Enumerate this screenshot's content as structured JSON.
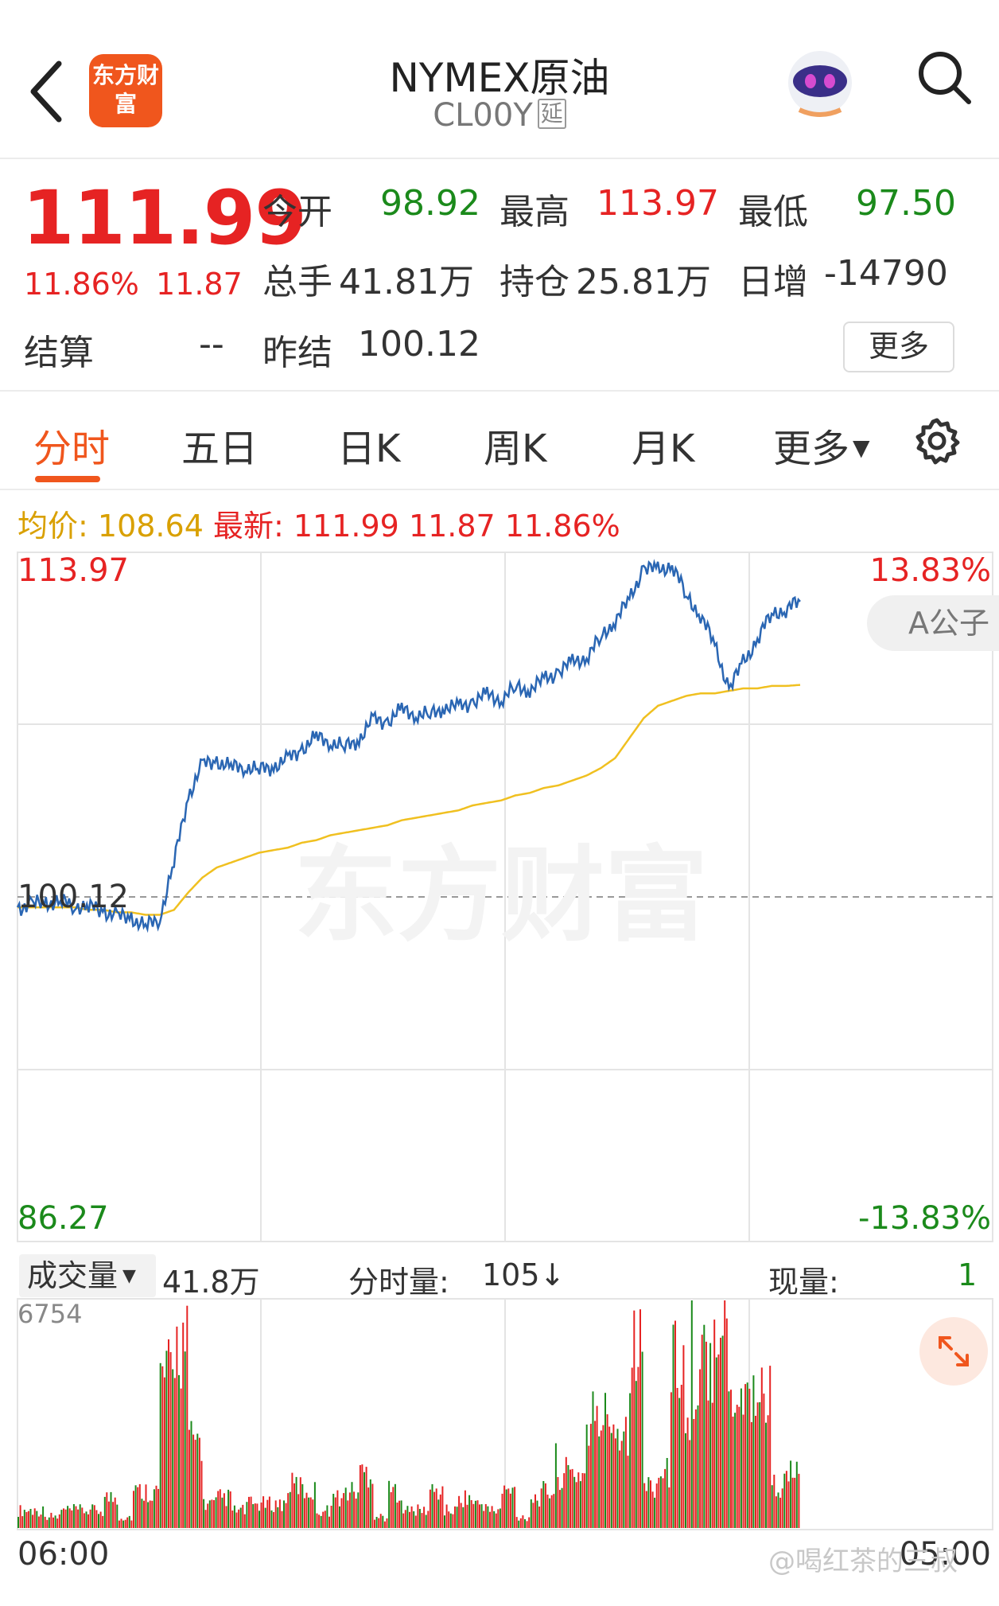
{
  "header": {
    "app_logo_text": "东方财富",
    "title": "NYMEX原油",
    "code": "CL00Y",
    "delay_tag": "延"
  },
  "quote": {
    "price": "111.99",
    "change_pct": "11.86%",
    "change": "11.87",
    "open_label": "今开",
    "open": "98.92",
    "high_label": "最高",
    "high": "113.97",
    "low_label": "最低",
    "low": "97.50",
    "volume_label": "总手",
    "volume": "41.81万",
    "oi_label": "持仓",
    "oi": "25.81万",
    "daily_inc_label": "日增",
    "daily_inc": "-14790",
    "settle_label": "结算",
    "settle": "--",
    "prev_settle_label": "昨结",
    "prev_settle": "100.12",
    "more_button": "更多"
  },
  "tabs": [
    "分时",
    "五日",
    "日K",
    "周K",
    "月K",
    "更多"
  ],
  "legend": {
    "avg_label": "均价:",
    "avg": "108.64",
    "latest_label": "最新:",
    "latest": "111.99",
    "latest_change": "11.87",
    "latest_pct": "11.86%"
  },
  "chart": {
    "y_top": "113.97",
    "y_mid": "100.12",
    "y_bottom": "86.27",
    "pct_top": "13.83%",
    "pct_bottom": "-13.83%",
    "a_button": "A公子",
    "watermark": "东方财富"
  },
  "volume_bar": {
    "selector": "成交量",
    "total": "41.8万",
    "tick_label": "分时量:",
    "tick_value": "105↓",
    "now_label": "现量:",
    "now_value": "1",
    "max_label": "6754"
  },
  "time_axis": {
    "start": "06:00",
    "end": "05:00"
  },
  "watermark_bottom": "@喝红茶的三叔",
  "colors": {
    "up": "#e62323",
    "down": "#1b8a1b",
    "accent": "#f0561d",
    "avg_line": "#f0c020",
    "price_line": "#2a66b3"
  },
  "chart_data": {
    "type": "line",
    "ylim": [
      86.27,
      113.97
    ],
    "prev_close": 100.12,
    "series": [
      {
        "name": "最新",
        "values": [
          99.7,
          99.8,
          99.9,
          99.9,
          99.8,
          99.7,
          99.6,
          99.3,
          99.3,
          98.9,
          99.3,
          101.5,
          104.2,
          105.4,
          105.6,
          105.3,
          105.4,
          105.2,
          105.4,
          105.6,
          106.1,
          106.5,
          106.4,
          106.1,
          106.5,
          107.2,
          107.2,
          107.6,
          107.5,
          107.4,
          107.8,
          107.7,
          108.0,
          108.2,
          108.1,
          108.5,
          108.5,
          108.8,
          109.2,
          109.5,
          109.8,
          110.5,
          111.3,
          112.0,
          113.4,
          113.2,
          113.5,
          112.2,
          111.5,
          110.2,
          108.5,
          109.5,
          110.5,
          111.5,
          111.7,
          111.99
        ]
      },
      {
        "name": "均价",
        "values": [
          99.7,
          99.7,
          99.7,
          99.7,
          99.7,
          99.6,
          99.6,
          99.5,
          99.5,
          99.4,
          99.4,
          99.6,
          100.3,
          100.9,
          101.3,
          101.5,
          101.7,
          101.9,
          102.0,
          102.1,
          102.3,
          102.4,
          102.6,
          102.7,
          102.8,
          102.9,
          103.0,
          103.2,
          103.3,
          103.4,
          103.5,
          103.6,
          103.8,
          103.9,
          104.0,
          104.2,
          104.3,
          104.5,
          104.6,
          104.8,
          105.0,
          105.3,
          105.7,
          106.5,
          107.3,
          107.8,
          108.0,
          108.2,
          108.3,
          108.3,
          108.4,
          108.5,
          108.5,
          108.6,
          108.6,
          108.64
        ]
      }
    ],
    "volume_max": 6754
  }
}
